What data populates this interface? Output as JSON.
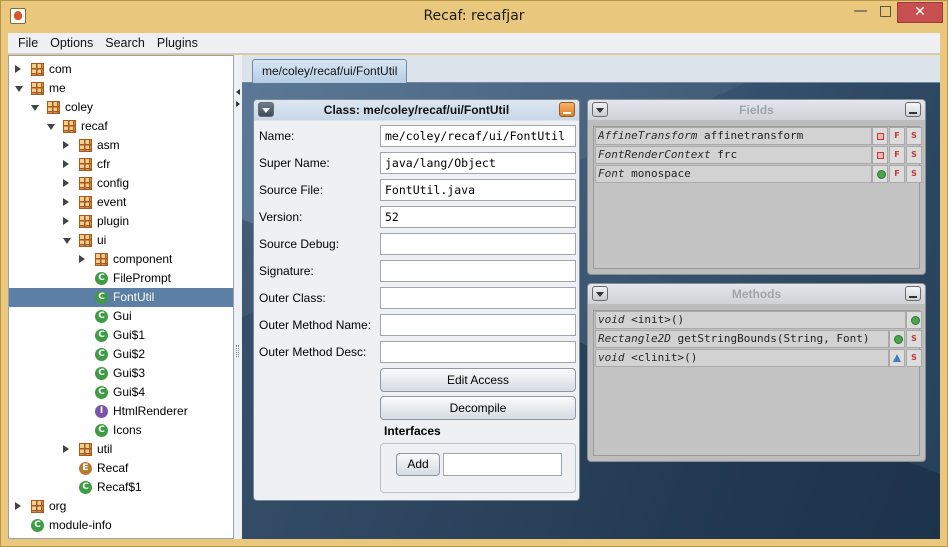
{
  "window": {
    "title": "Recaf: recafjar",
    "minimize_glyph": "—",
    "maximize_glyph": "□",
    "close_glyph": "✕"
  },
  "menu": [
    "File",
    "Options",
    "Search",
    "Plugins"
  ],
  "tree": {
    "items": [
      {
        "label": "com",
        "type": "package",
        "depth": 0,
        "state": "collapsed"
      },
      {
        "label": "me",
        "type": "package",
        "depth": 0,
        "state": "expanded"
      },
      {
        "label": "coley",
        "type": "package",
        "depth": 1,
        "state": "expanded"
      },
      {
        "label": "recaf",
        "type": "package",
        "depth": 2,
        "state": "expanded"
      },
      {
        "label": "asm",
        "type": "package",
        "depth": 3,
        "state": "collapsed"
      },
      {
        "label": "cfr",
        "type": "package",
        "depth": 3,
        "state": "collapsed"
      },
      {
        "label": "config",
        "type": "package",
        "depth": 3,
        "state": "collapsed"
      },
      {
        "label": "event",
        "type": "package",
        "depth": 3,
        "state": "collapsed"
      },
      {
        "label": "plugin",
        "type": "package",
        "depth": 3,
        "state": "collapsed"
      },
      {
        "label": "ui",
        "type": "package",
        "depth": 3,
        "state": "expanded"
      },
      {
        "label": "component",
        "type": "package",
        "depth": 4,
        "state": "collapsed"
      },
      {
        "label": "FilePrompt",
        "type": "class",
        "depth": 4
      },
      {
        "label": "FontUtil",
        "type": "class",
        "depth": 4,
        "selected": true
      },
      {
        "label": "Gui",
        "type": "class",
        "depth": 4
      },
      {
        "label": "Gui$1",
        "type": "class",
        "depth": 4
      },
      {
        "label": "Gui$2",
        "type": "class",
        "depth": 4
      },
      {
        "label": "Gui$3",
        "type": "class",
        "depth": 4
      },
      {
        "label": "Gui$4",
        "type": "class",
        "depth": 4
      },
      {
        "label": "HtmlRenderer",
        "type": "interface",
        "depth": 4
      },
      {
        "label": "Icons",
        "type": "class",
        "depth": 4
      },
      {
        "label": "util",
        "type": "package",
        "depth": 3,
        "state": "collapsed"
      },
      {
        "label": "Recaf",
        "type": "enum",
        "depth": 3
      },
      {
        "label": "Recaf$1",
        "type": "class",
        "depth": 3
      },
      {
        "label": "org",
        "type": "package",
        "depth": 0,
        "state": "collapsed"
      },
      {
        "label": "module-info",
        "type": "class",
        "depth": 0
      }
    ]
  },
  "tab": {
    "label": "me/coley/recaf/ui/FontUtil"
  },
  "class_frame": {
    "title": "Class: me/coley/recaf/ui/FontUtil",
    "fields": [
      {
        "label": "Name:",
        "value": "me/coley/recaf/ui/FontUtil"
      },
      {
        "label": "Super Name:",
        "value": "java/lang/Object"
      },
      {
        "label": "Source File:",
        "value": "FontUtil.java"
      },
      {
        "label": "Version:",
        "value": "52"
      },
      {
        "label": "Source Debug:",
        "value": ""
      },
      {
        "label": "Signature:",
        "value": ""
      },
      {
        "label": "Outer Class:",
        "value": ""
      },
      {
        "label": "Outer Method Name:",
        "value": ""
      },
      {
        "label": "Outer Method Desc:",
        "value": ""
      }
    ],
    "edit_access_label": "Edit Access",
    "decompile_label": "Decompile",
    "interfaces_title": "Interfaces",
    "add_label": "Add",
    "add_value": ""
  },
  "fields_frame": {
    "title": "Fields",
    "rows": [
      {
        "type": "AffineTransform",
        "name": "affinetransform",
        "access": "private",
        "flags": [
          "F",
          "S"
        ]
      },
      {
        "type": "FontRenderContext",
        "name": "frc",
        "access": "private",
        "flags": [
          "F",
          "S"
        ]
      },
      {
        "type": "Font",
        "name": "monospace",
        "access": "public",
        "flags": [
          "F",
          "S"
        ]
      }
    ]
  },
  "methods_frame": {
    "title": "Methods",
    "rows": [
      {
        "type": "void",
        "name": "<init>()",
        "access": "public",
        "flags": []
      },
      {
        "type": "Rectangle2D",
        "name": "getStringBounds(String, Font)",
        "access": "public",
        "flags": [
          "S"
        ]
      },
      {
        "type": "void",
        "name": "<clinit>()",
        "access": "package",
        "flags": [
          "S"
        ]
      }
    ]
  },
  "colors": {
    "title_bar": "#e9c77d",
    "selection": "#5c7fa5",
    "class_icon": "#3e9c45",
    "interface_icon": "#7b54a8",
    "enum_icon": "#b77a31",
    "package_icon": "#a85a1e"
  }
}
